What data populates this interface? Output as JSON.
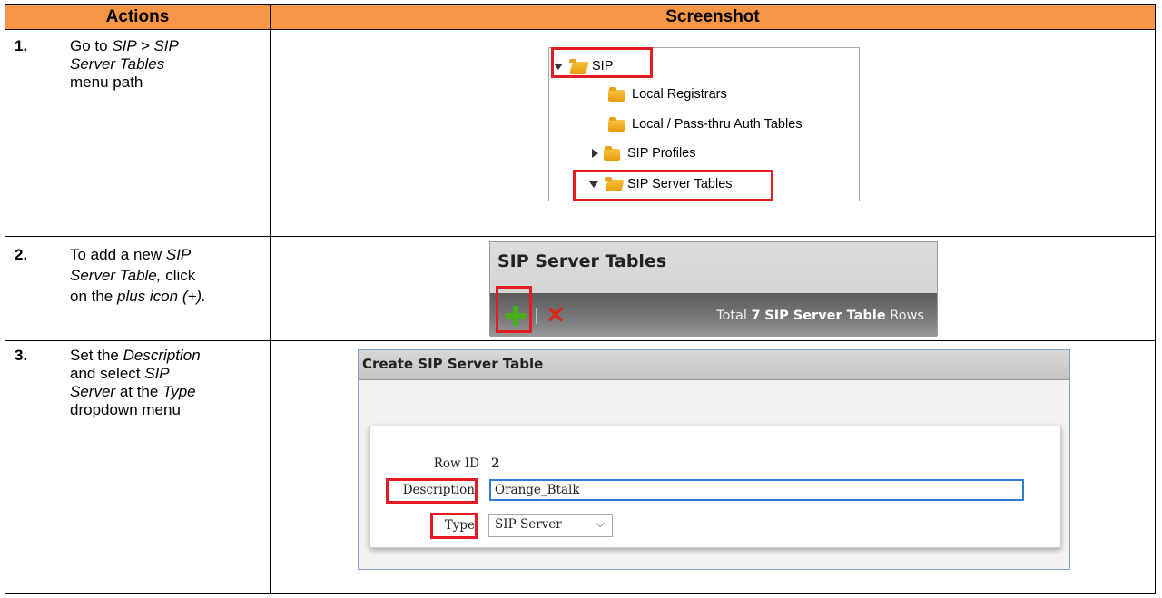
{
  "headers": {
    "actions": "Actions",
    "screenshot": "Screenshot"
  },
  "colors": {
    "header_bg": "#f79646",
    "highlight": "#e31b23",
    "plus": "#46b01c",
    "delete": "#d8281b"
  },
  "steps": [
    {
      "num": "1.",
      "lines": [
        "Go to",
        "SIP > SIP",
        "Server Tables",
        "menu path"
      ]
    },
    {
      "num": "2.",
      "lines": [
        "To add a new",
        "SIP",
        "Server Table,",
        "click",
        "on the",
        "plus icon (+)."
      ]
    },
    {
      "num": "3.",
      "lines": [
        "Set the",
        "Description",
        "and select",
        "SIP",
        "Server",
        "at the",
        "Type",
        "dropdown menu"
      ]
    }
  ],
  "tree": {
    "items": [
      "SIP",
      "Local Registrars",
      "Local / Pass-thru Auth Tables",
      "SIP Profiles",
      "SIP Server Tables"
    ],
    "icons": [
      "expand-triangle-icon",
      "folder-icon"
    ]
  },
  "toolbar": {
    "title": "SIP Server Tables",
    "total_prefix": "Total",
    "total_count": "7",
    "total_entity": "SIP Server Table",
    "total_suffix": "Rows",
    "icons": [
      "plus-icon",
      "delete-icon"
    ]
  },
  "dialog": {
    "title": "Create SIP Server Table",
    "row_id_label": "Row ID",
    "row_id_value": "2",
    "description_label": "Description",
    "description_value": "Orange_Btalk",
    "type_label": "Type",
    "type_value": "SIP Server"
  }
}
